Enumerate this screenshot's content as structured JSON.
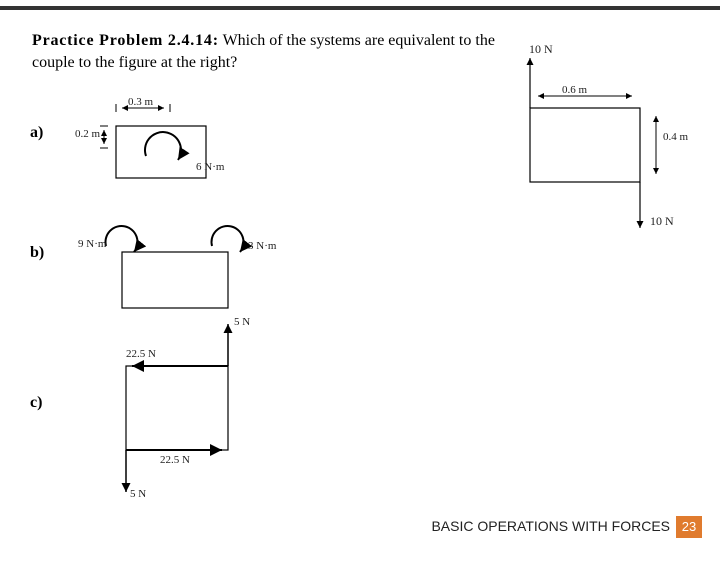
{
  "title_prefix": "Practice  Problem  2.4.14:",
  "question_rest": " Which  of  the  systems  are equivalent to the couple to the figure at the right?",
  "parts": {
    "a": "a)",
    "b": "b)",
    "c": "c)"
  },
  "ref_fig": {
    "force_top": "10 N",
    "force_right": "10 N",
    "dim_w": "0.6 m",
    "dim_h": "0.4 m"
  },
  "a": {
    "dim_w": "0.3 m",
    "dim_h": "0.2 m",
    "moment": "6 N·m"
  },
  "b": {
    "m1": "9 N·m",
    "m2": "3 N·m"
  },
  "c": {
    "f_top": "22.5 N",
    "f_bot": "22.5 N",
    "f_left": "5 N",
    "f_right": "5 N"
  },
  "footer": {
    "text": "BASIC OPERATIONS WITH FORCES",
    "page": "23"
  }
}
